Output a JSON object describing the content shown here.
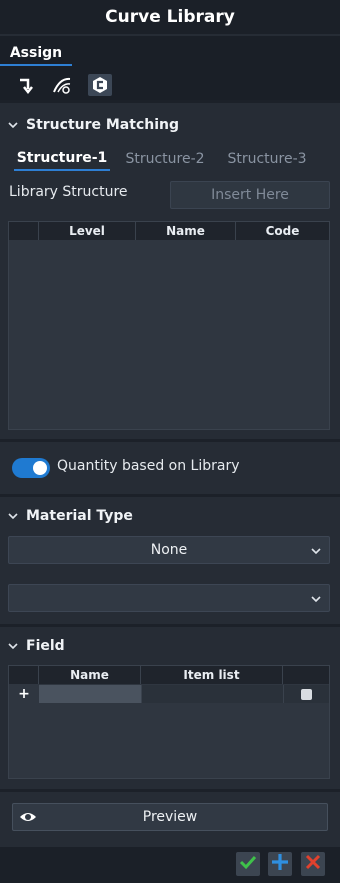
{
  "window": {
    "title": "Curve Library"
  },
  "tabs": {
    "assign_label": "Assign"
  },
  "toolbar": {
    "icons": [
      "return-arrow-icon",
      "curve-tool-icon",
      "library-icon"
    ]
  },
  "structure_matching": {
    "title": "Structure Matching",
    "tabs": [
      "Structure-1",
      "Structure-2",
      "Structure-3"
    ],
    "active_tab": 0,
    "library_structure_label": "Library Structure",
    "insert_placeholder": "Insert Here",
    "table_headers": [
      "",
      "Level",
      "Name",
      "Code"
    ]
  },
  "quantity_toggle": {
    "label": "Quantity based on Library",
    "on": true
  },
  "material_type": {
    "title": "Material Type",
    "selected": "None",
    "second_selected": ""
  },
  "field": {
    "title": "Field",
    "table_headers": [
      "",
      "Name",
      "Item list",
      ""
    ],
    "add_row_symbol": "+"
  },
  "preview": {
    "label": "Preview"
  },
  "footer": {
    "buttons": [
      "confirm",
      "add",
      "close"
    ],
    "colors": {
      "confirm": "#3fc14a",
      "add": "#2f8fe0",
      "close": "#e0412d"
    }
  },
  "colors": {
    "accent": "#1f7ad1",
    "background": "#262c35"
  }
}
